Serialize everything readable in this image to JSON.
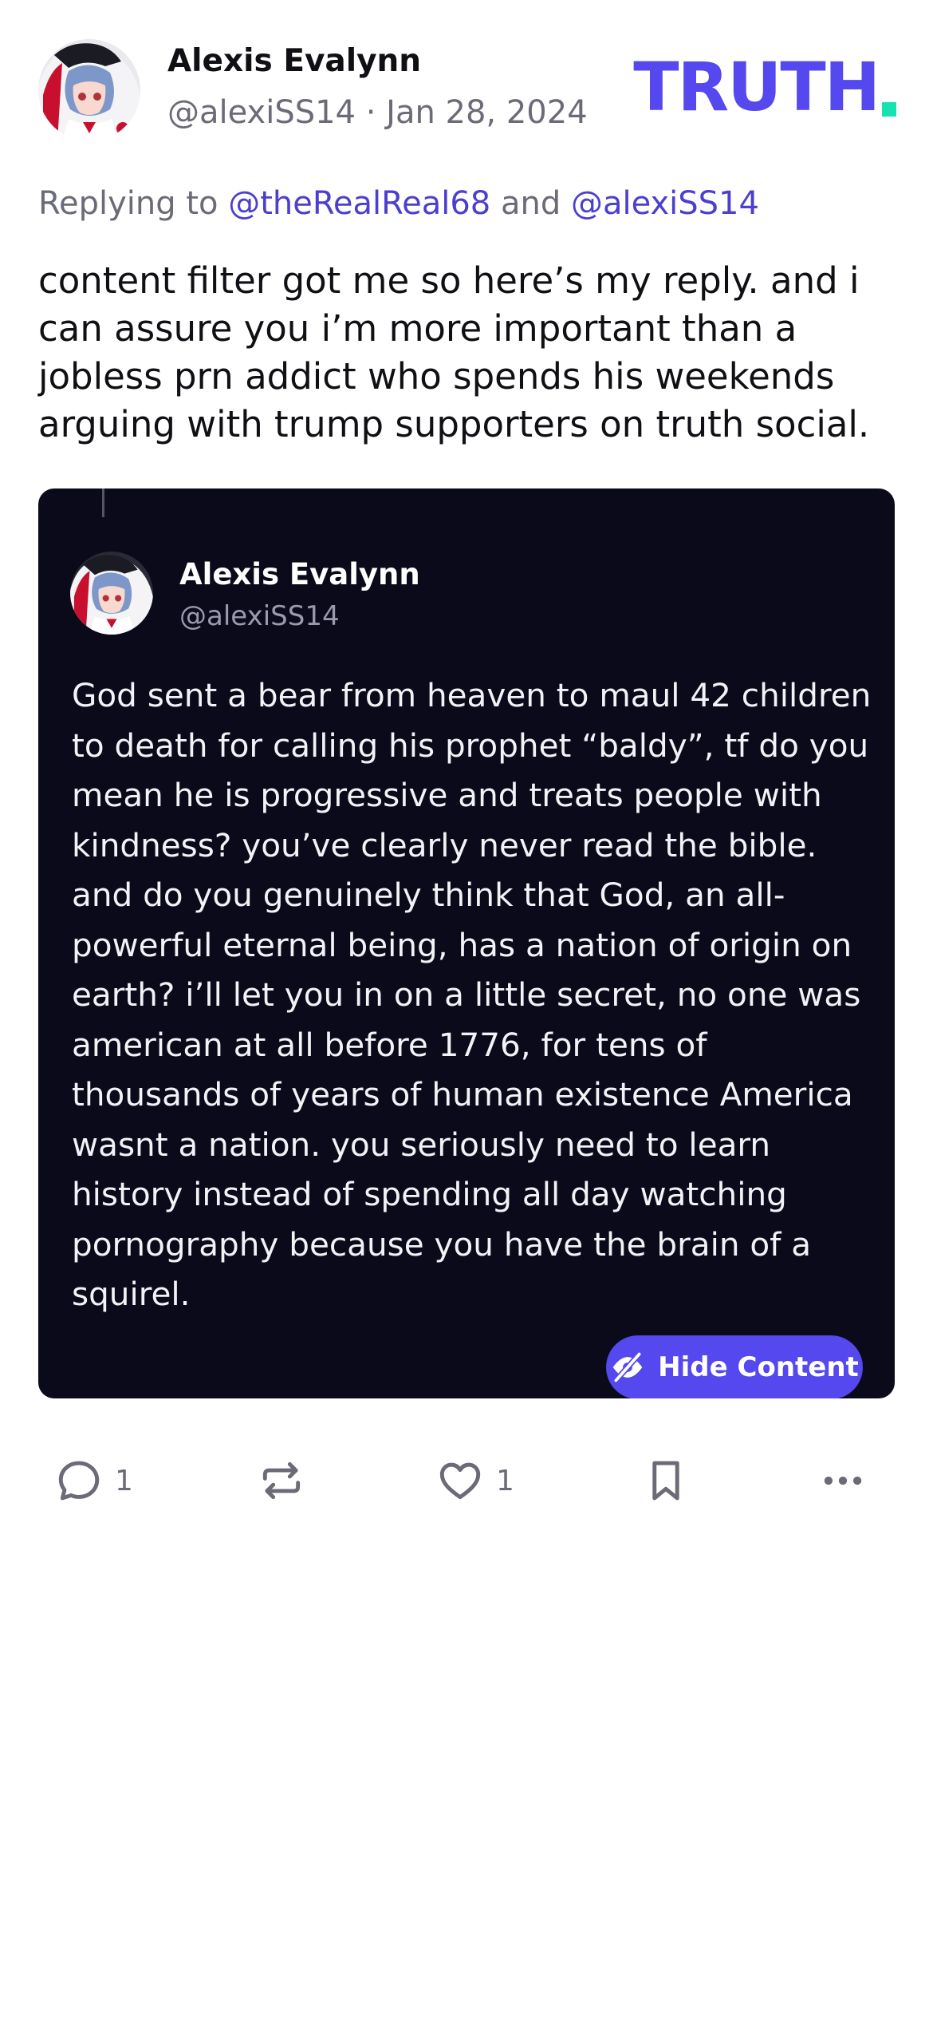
{
  "post": {
    "author": {
      "display_name": "Alexis Evalynn",
      "meta": "@alexiSS14 · Jan 28, 2024",
      "avatar_icon": "anime-avatar-icon"
    },
    "logo": {
      "text": "TRUTH",
      "dot_color": "#17e2b2",
      "color": "#5448ee"
    },
    "replying": {
      "prefix": "Replying to",
      "mention1": "@theRealReal68",
      "conjunction": "and",
      "mention2": "@alexiSS14"
    },
    "body": "content filter got me so here’s my reply. and i can assure you i’m more important than a jobless prn addict who spends his weekends arguing with trump supporters on truth social."
  },
  "quoted": {
    "display_name": "Alexis Evalynn",
    "handle": "@alexiSS14",
    "text": "God sent a bear from heaven to maul 42 children to death for calling his prophet “baldy”, tf do you mean he is progressive and treats people with kindness? you’ve clearly never read the bible. and do you genuinely think that God, an all-powerful eternal being, has a nation of origin on earth? i’ll let you in on a little secret, no one was american at all before 1776, for tens of thousands of years of human existence America wasnt a nation. you seriously need to learn history instead of spending all day watching pornography because you have the brain of a squirel.",
    "hide_button": "Hide Content",
    "card_color": "#0b0a1a"
  },
  "actions": {
    "reply_count": "1",
    "like_count": "1",
    "icons": [
      "comment-icon",
      "repost-icon",
      "heart-icon",
      "bookmark-icon",
      "more-icon"
    ]
  }
}
